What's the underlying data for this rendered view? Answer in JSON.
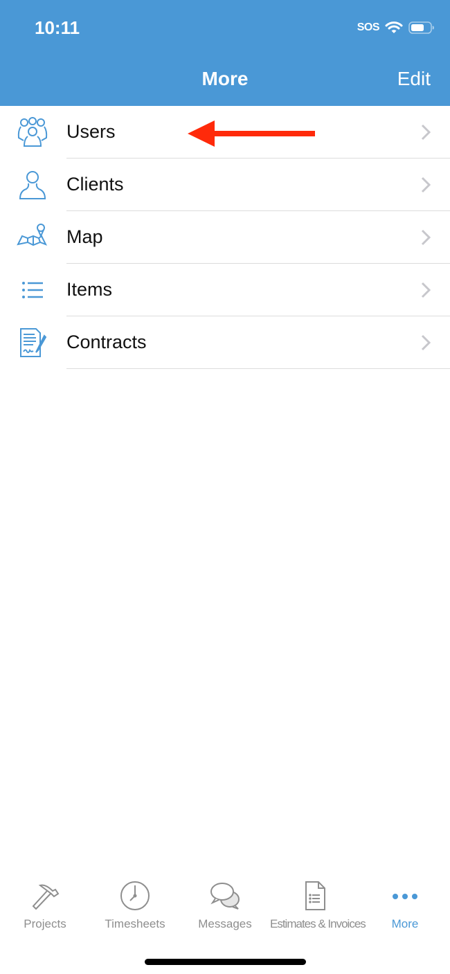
{
  "status_bar": {
    "time": "10:11",
    "carrier": "SOS",
    "wifi_icon": "wifi-icon",
    "battery_icon": "battery-icon"
  },
  "nav": {
    "title": "More",
    "edit_label": "Edit"
  },
  "list": {
    "items": [
      {
        "label": "Users",
        "icon": "users-group-icon"
      },
      {
        "label": "Clients",
        "icon": "person-icon"
      },
      {
        "label": "Map",
        "icon": "map-pin-icon"
      },
      {
        "label": "Items",
        "icon": "list-icon"
      },
      {
        "label": "Contracts",
        "icon": "contract-signature-icon"
      }
    ]
  },
  "annotation": {
    "type": "arrow",
    "color": "#ff2a0a",
    "points_to": "Users"
  },
  "tabs": [
    {
      "label": "Projects",
      "icon": "hammer-icon",
      "active": false
    },
    {
      "label": "Timesheets",
      "icon": "clock-icon",
      "active": false
    },
    {
      "label": "Messages",
      "icon": "chat-bubbles-icon",
      "active": false
    },
    {
      "label": "Estimates & Invoices",
      "icon": "document-icon",
      "active": false
    },
    {
      "label": "More",
      "icon": "more-dots-icon",
      "active": true
    }
  ],
  "colors": {
    "accent": "#4a98d6",
    "inactive": "#8e8e8e",
    "chevron": "#c7c7cc"
  }
}
